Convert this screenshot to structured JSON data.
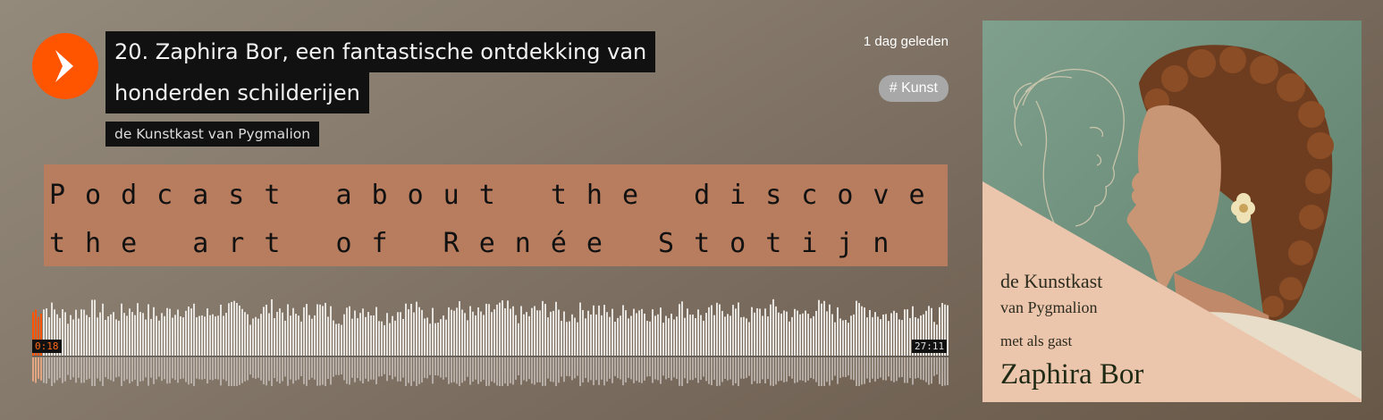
{
  "track": {
    "title_line1": "20. Zaphira Bor, een fantastische ontdekking van",
    "title_line2": "honderden schilderijen",
    "artist": "de Kunstkast van Pygmalion",
    "posted": "1 dag geleden",
    "tag": "# Kunst"
  },
  "description": {
    "line1": "Podcast about the discovery of",
    "line2": "the art of Renée Stotijn (Dutch)"
  },
  "player": {
    "current_time": "0:18",
    "duration": "27:11",
    "progress_fraction": 0.011,
    "played_color": "#ff5500"
  },
  "artwork": {
    "line1": "de Kunstkast",
    "line2": "van Pygmalion",
    "line3": "met als gast",
    "line4": "Zaphira Bor"
  },
  "icons": {
    "play": "play-icon"
  },
  "colors": {
    "accent": "#ff5500",
    "description_bg": "#b87d5e",
    "tag_bg": "#a8a8a8"
  }
}
